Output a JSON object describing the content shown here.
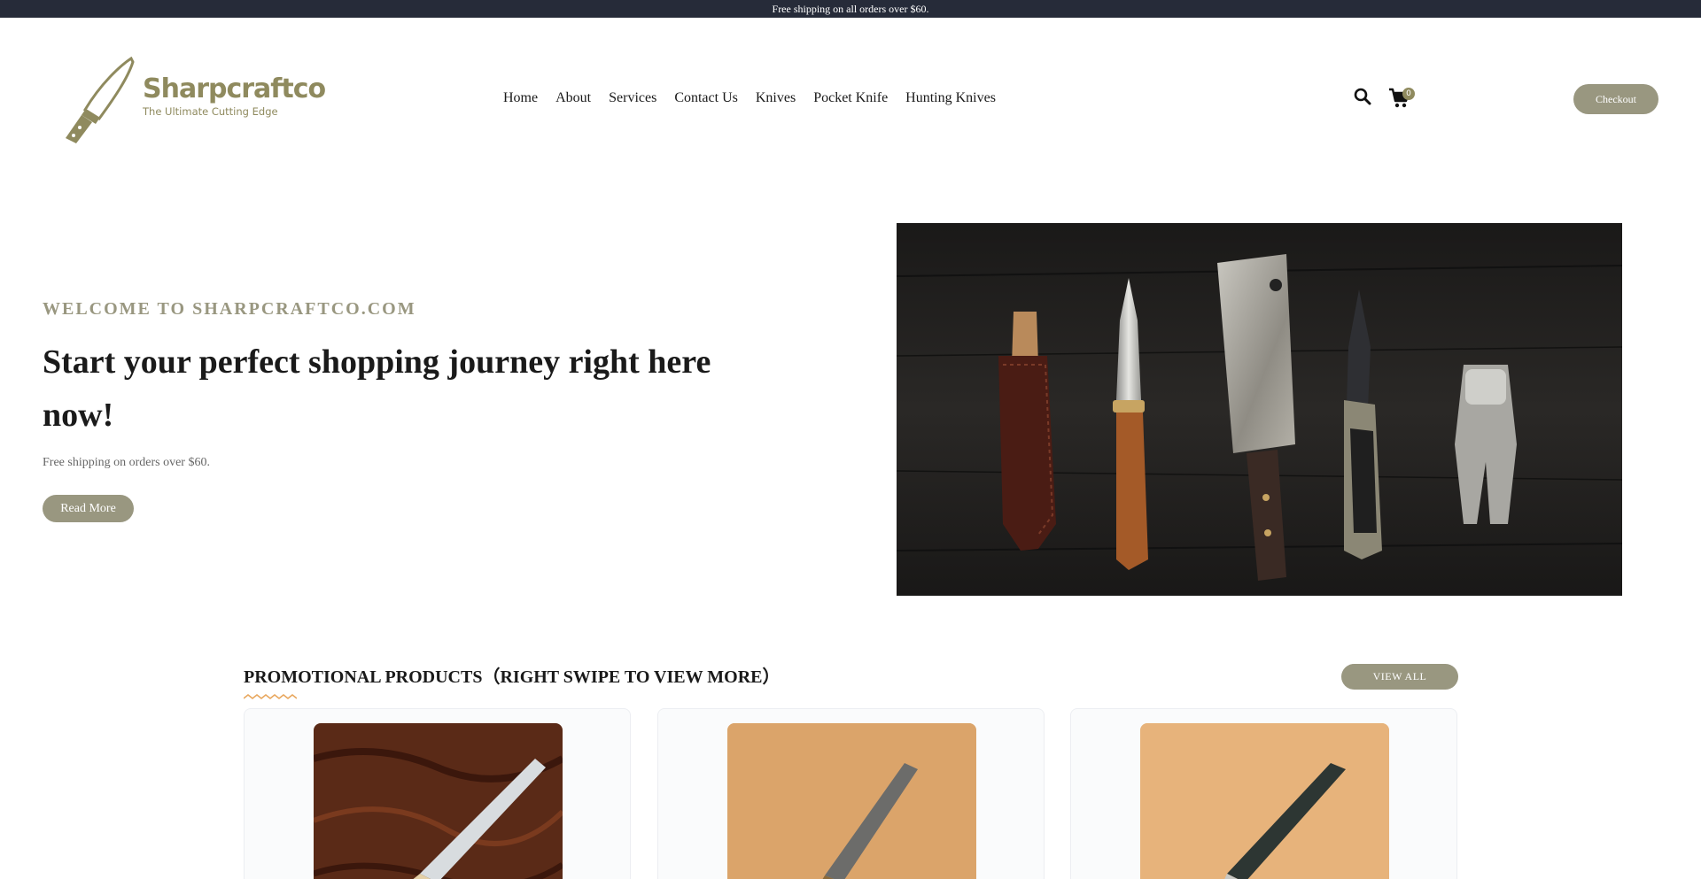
{
  "topbar": {
    "text": "Free shipping on all orders over $60."
  },
  "brand": {
    "name": "Sharpcraftco",
    "tagline": "The Ultimate Cutting Edge",
    "color": "#8f8a5e"
  },
  "nav": {
    "items": [
      {
        "label": "Home"
      },
      {
        "label": "About"
      },
      {
        "label": "Services"
      },
      {
        "label": "Contact Us"
      },
      {
        "label": "Knives"
      },
      {
        "label": "Pocket Knife"
      },
      {
        "label": "Hunting Knives"
      }
    ]
  },
  "header_actions": {
    "search_icon": "search-icon",
    "cart_icon": "cart-icon",
    "cart_count": "0",
    "checkout_label": "Checkout"
  },
  "hero": {
    "kicker": "WELCOME TO SHARPCRAFTCO.COM",
    "title": "Start your perfect shopping journey right here now!",
    "subtitle": "Free shipping on orders over $60.",
    "button_label": "Read More"
  },
  "promo": {
    "title": "PROMOTIONAL PRODUCTS（RIGHT SWIPE TO VIEW MORE）",
    "view_all_label": "VIEW ALL",
    "products": [
      {
        "name": ""
      },
      {
        "name": ""
      },
      {
        "name": ""
      }
    ]
  },
  "colors": {
    "accent": "#999780",
    "topbar_bg": "#262b39",
    "text": "#1a1a1a"
  }
}
